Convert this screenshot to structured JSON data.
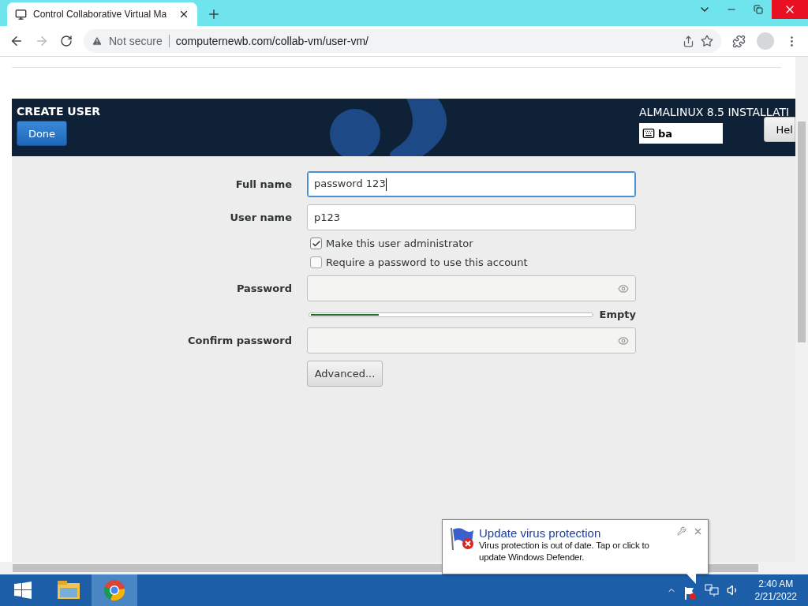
{
  "browser": {
    "tab_title": "Control Collaborative Virtual Ma",
    "security": "Not secure",
    "url": "computernewb.com/collab-vm/user-vm/"
  },
  "installer": {
    "title": "CREATE USER",
    "done_button": "Done",
    "product": "ALMALINUX 8.5 INSTALLATI",
    "keyboard_layout": "ba",
    "help_button": "Hel"
  },
  "form": {
    "fields": [
      {
        "kind": "text",
        "label": "Full name",
        "value": "password 123",
        "focused": true
      },
      {
        "kind": "text",
        "label": "User name",
        "value": "p123",
        "focused": false
      },
      {
        "kind": "checkbox",
        "label": "Make this user administrator",
        "checked": true
      },
      {
        "kind": "checkbox",
        "label": "Require a password to use this account",
        "checked": false
      },
      {
        "kind": "password",
        "label": "Password",
        "focused": false
      },
      {
        "kind": "meter",
        "level": 0.25,
        "reading": "Empty"
      },
      {
        "kind": "password",
        "label": "Confirm password",
        "focused": false
      },
      {
        "kind": "button",
        "label": "Advanced..."
      }
    ]
  },
  "notification": {
    "title": "Update virus protection",
    "body": "Virus protection is out of date. Tap or click to update Windows Defender."
  },
  "taskbar": {
    "time": "2:40 AM",
    "date": "2/21/2022"
  }
}
